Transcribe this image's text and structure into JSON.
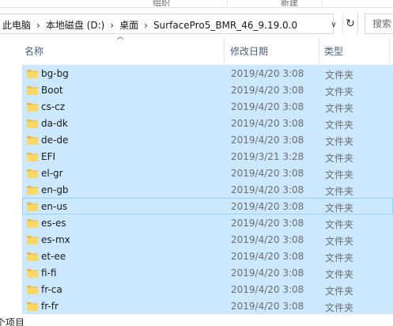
{
  "ribbon": {
    "groups": [
      "组织",
      "新建"
    ]
  },
  "address_bar": {
    "crumbs": [
      "此电脑",
      "本地磁盘 (D:)",
      "桌面",
      "SurfacePro5_BMR_46_9.19.0.0"
    ],
    "separator": "›",
    "dropdown_glyph": "∨",
    "refresh_glyph": "↻"
  },
  "search": {
    "placeholder": "搜索"
  },
  "columns": {
    "sort_glyph": "^",
    "name": "名称",
    "date": "修改日期",
    "type": "类型"
  },
  "files": [
    {
      "name": "bg-bg",
      "date": "2019/4/20 3:08",
      "type": "文件夹"
    },
    {
      "name": "Boot",
      "date": "2019/4/20 3:08",
      "type": "文件夹"
    },
    {
      "name": "cs-cz",
      "date": "2019/4/20 3:08",
      "type": "文件夹"
    },
    {
      "name": "da-dk",
      "date": "2019/4/20 3:08",
      "type": "文件夹"
    },
    {
      "name": "de-de",
      "date": "2019/4/20 3:08",
      "type": "文件夹"
    },
    {
      "name": "EFI",
      "date": "2019/3/21 3:28",
      "type": "文件夹"
    },
    {
      "name": "el-gr",
      "date": "2019/4/20 3:08",
      "type": "文件夹"
    },
    {
      "name": "en-gb",
      "date": "2019/4/20 3:08",
      "type": "文件夹"
    },
    {
      "name": "en-us",
      "date": "2019/4/20 3:08",
      "type": "文件夹"
    },
    {
      "name": "es-es",
      "date": "2019/4/20 3:08",
      "type": "文件夹"
    },
    {
      "name": "es-mx",
      "date": "2019/4/20 3:08",
      "type": "文件夹"
    },
    {
      "name": "et-ee",
      "date": "2019/4/20 3:08",
      "type": "文件夹"
    },
    {
      "name": "fi-fi",
      "date": "2019/4/20 3:08",
      "type": "文件夹"
    },
    {
      "name": "fr-ca",
      "date": "2019/4/20 3:08",
      "type": "文件夹"
    },
    {
      "name": "fr-fr",
      "date": "2019/4/20 3:08",
      "type": "文件夹"
    }
  ],
  "status": {
    "text": "个项目"
  },
  "colors": {
    "selection": "#cce8ff",
    "focus_border": "#99d1ff",
    "folder": "#ffd763",
    "header_text": "#4c607a"
  },
  "icons": {
    "folder": "folder-icon"
  }
}
